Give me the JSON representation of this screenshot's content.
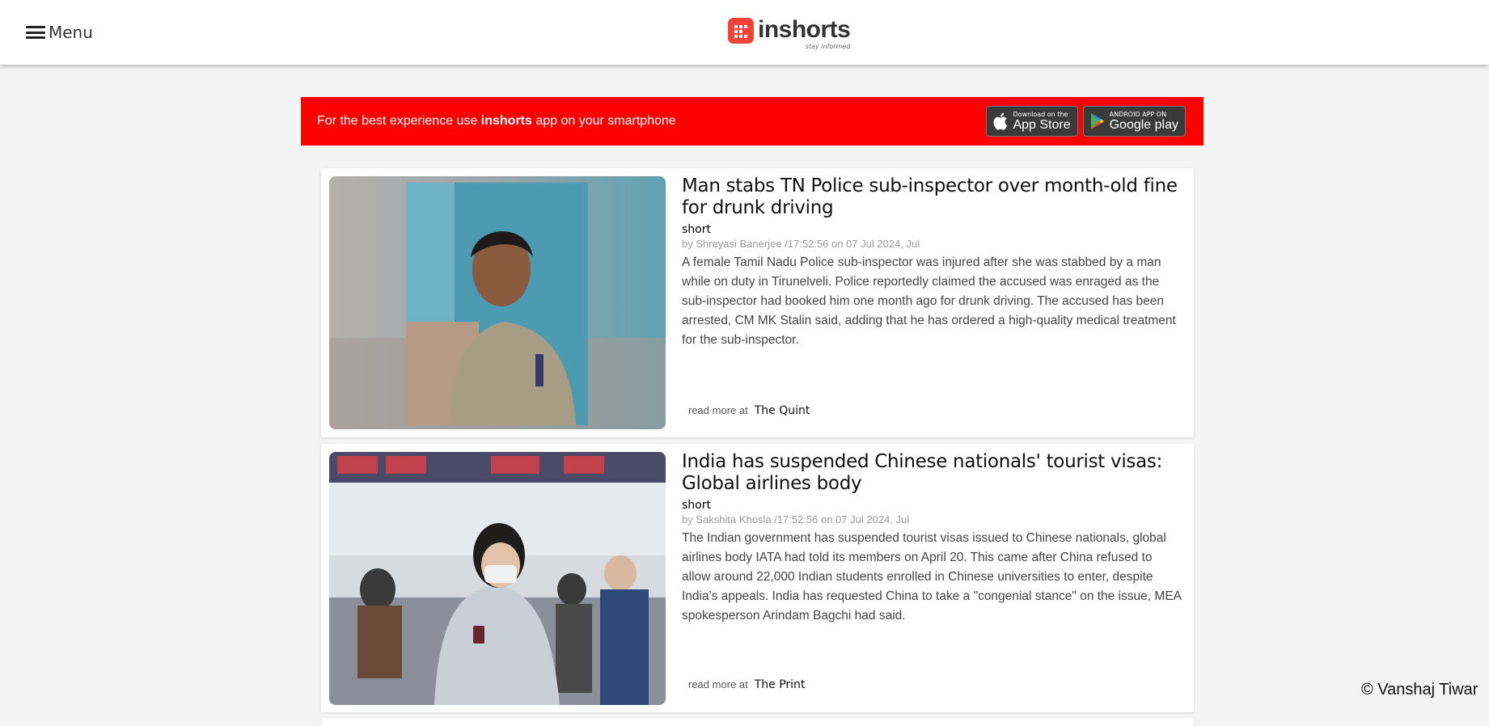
{
  "header": {
    "menu_label": "Menu",
    "logo_text": "inshorts",
    "logo_tagline": "stay informed"
  },
  "banner": {
    "text_before": "For the best experience use ",
    "brand": "inshorts",
    "text_after": " app on your smartphone",
    "app_store_small": "Download on the",
    "app_store_big": "App Store",
    "google_play_small": "ANDROID APP ON",
    "google_play_big": "Google play"
  },
  "articles": [
    {
      "title": "Man stabs TN Police sub-inspector over month-old fine for drunk driving",
      "type_label": "short",
      "byline": "by Shreyasi Banerjee /17:52:56 on 07 Jul 2024, Jul",
      "body": "A female Tamil Nadu Police sub-inspector was injured after she was stabbed by a man while on duty in Tirunelveli. Police reportedly claimed the accused was enraged as the sub-inspector had booked him one month ago for drunk driving. The accused has been arrested, CM MK Stalin said, adding that he has ordered a high-quality medical treatment for the sub-inspector.",
      "read_more_label": "read more at",
      "source": "The Quint"
    },
    {
      "title": "India has suspended Chinese nationals' tourist visas: Global airlines body",
      "type_label": "short",
      "byline": "by Sakshita Khosla /17:52:56 on 07 Jul 2024, Jul",
      "body": "The Indian government has suspended tourist visas issued to Chinese nationals, global airlines body IATA had told its members on April 20. This came after China refused to allow around 22,000 Indian students enrolled in Chinese universities to enter, despite India's appeals. India has requested China to take a \"congenial stance\" on the issue, MEA spokesperson Arindam Bagchi had said.",
      "read_more_label": "read more at",
      "source": "The Print"
    }
  ],
  "footer": {
    "copyright": "© Vanshaj Tiwar"
  },
  "colors": {
    "banner_red": "#ff0000",
    "logo_red": "#f44336"
  }
}
